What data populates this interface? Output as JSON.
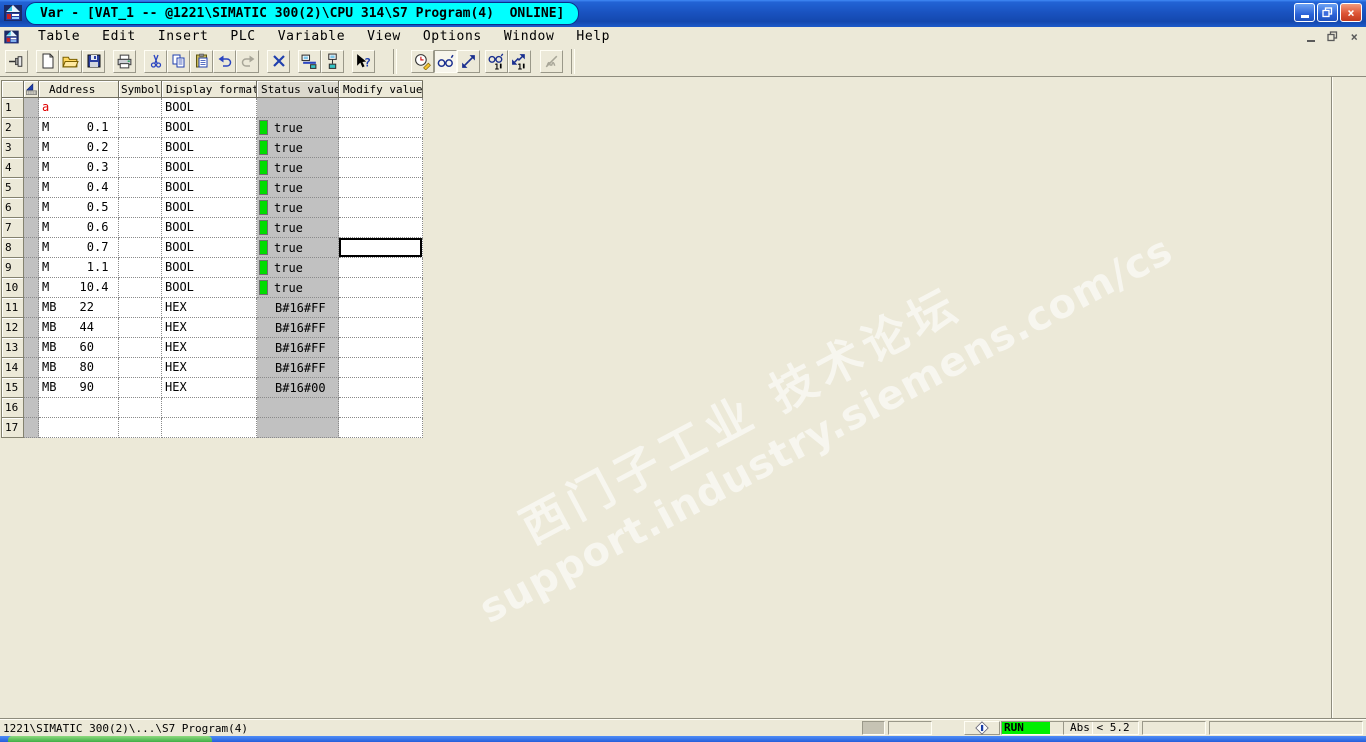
{
  "window": {
    "title": "Var - [VAT_1 -- @1221\\SIMATIC 300(2)\\CPU 314\\S7 Program(4)  ONLINE]",
    "online_badge": "ONLINE",
    "accent_colors": {
      "titlebar_blue": "#1a53c0",
      "title_pill_cyan": "#00ffff",
      "close_red": "#dd5536"
    }
  },
  "menu": {
    "items": [
      "Table",
      "Edit",
      "Insert",
      "PLC",
      "Variable",
      "View",
      "Options",
      "Window",
      "Help"
    ]
  },
  "toolbar": {
    "icons": [
      "pin-icon",
      "new-document-icon",
      "open-folder-icon",
      "save-icon",
      "print-icon",
      "cut-icon",
      "copy-icon",
      "paste-icon",
      "undo-icon",
      "redo-icon",
      "delete-x-icon",
      "download-to-plc-icon",
      "plc-connection-icon",
      "help-pointer-icon",
      "monitor-trigger-icon",
      "monitor-variables-icon",
      "modify-variables-icon",
      "monitor-once-icon",
      "modify-once-icon",
      "deactivate-modify-icon"
    ],
    "monitor_variables_pressed": true
  },
  "table": {
    "headers": [
      "Address",
      "Symbol",
      "Display format",
      "Status value",
      "Modify value"
    ],
    "status_column_bg": "#c1c1c1",
    "bool_true_color": "#00dc00",
    "rows": [
      {
        "num": "1",
        "p": "a",
        "b": "",
        "s": "",
        "red": true,
        "symbol": "",
        "format": "BOOL",
        "status": "",
        "led": false,
        "sel": false
      },
      {
        "num": "2",
        "p": "M",
        "b": "0",
        "s": ".1",
        "red": false,
        "symbol": "",
        "format": "BOOL",
        "status": "true",
        "led": true,
        "sel": false
      },
      {
        "num": "3",
        "p": "M",
        "b": "0",
        "s": ".2",
        "red": false,
        "symbol": "",
        "format": "BOOL",
        "status": "true",
        "led": true,
        "sel": false
      },
      {
        "num": "4",
        "p": "M",
        "b": "0",
        "s": ".3",
        "red": false,
        "symbol": "",
        "format": "BOOL",
        "status": "true",
        "led": true,
        "sel": false
      },
      {
        "num": "5",
        "p": "M",
        "b": "0",
        "s": ".4",
        "red": false,
        "symbol": "",
        "format": "BOOL",
        "status": "true",
        "led": true,
        "sel": false
      },
      {
        "num": "6",
        "p": "M",
        "b": "0",
        "s": ".5",
        "red": false,
        "symbol": "",
        "format": "BOOL",
        "status": "true",
        "led": true,
        "sel": false
      },
      {
        "num": "7",
        "p": "M",
        "b": "0",
        "s": ".6",
        "red": false,
        "symbol": "",
        "format": "BOOL",
        "status": "true",
        "led": true,
        "sel": false
      },
      {
        "num": "8",
        "p": "M",
        "b": "0",
        "s": ".7",
        "red": false,
        "symbol": "",
        "format": "BOOL",
        "status": "true",
        "led": true,
        "sel": true
      },
      {
        "num": "9",
        "p": "M",
        "b": "1",
        "s": ".1",
        "red": false,
        "symbol": "",
        "format": "BOOL",
        "status": "true",
        "led": true,
        "sel": false
      },
      {
        "num": "10",
        "p": "M",
        "b": "10",
        "s": ".4",
        "red": false,
        "symbol": "",
        "format": "BOOL",
        "status": "true",
        "led": true,
        "sel": false
      },
      {
        "num": "11",
        "p": "MB",
        "b": "22",
        "s": "",
        "red": false,
        "symbol": "",
        "format": "HEX",
        "status": "B#16#FF",
        "led": false,
        "sel": false
      },
      {
        "num": "12",
        "p": "MB",
        "b": "44",
        "s": "",
        "red": false,
        "symbol": "",
        "format": "HEX",
        "status": "B#16#FF",
        "led": false,
        "sel": false
      },
      {
        "num": "13",
        "p": "MB",
        "b": "60",
        "s": "",
        "red": false,
        "symbol": "",
        "format": "HEX",
        "status": "B#16#FF",
        "led": false,
        "sel": false
      },
      {
        "num": "14",
        "p": "MB",
        "b": "80",
        "s": "",
        "red": false,
        "symbol": "",
        "format": "HEX",
        "status": "B#16#FF",
        "led": false,
        "sel": false
      },
      {
        "num": "15",
        "p": "MB",
        "b": "90",
        "s": "",
        "red": false,
        "symbol": "",
        "format": "HEX",
        "status": "B#16#00",
        "led": false,
        "sel": false
      },
      {
        "num": "16",
        "p": "",
        "b": "",
        "s": "",
        "red": false,
        "symbol": "",
        "format": "",
        "status": "",
        "led": false,
        "sel": false
      },
      {
        "num": "17",
        "p": "",
        "b": "",
        "s": "",
        "red": false,
        "symbol": "",
        "format": "",
        "status": "",
        "led": false,
        "sel": false
      }
    ]
  },
  "statusbar": {
    "path": "1221\\SIMATIC 300(2)\\...\\S7 Program(4)",
    "run_state": "RUN",
    "run_bg": "#00ef00",
    "abs": "Abs < 5.2"
  },
  "watermark": {
    "line1": "西门子工业  技术论坛",
    "line2": "support.industry.siemens.com/cs"
  }
}
